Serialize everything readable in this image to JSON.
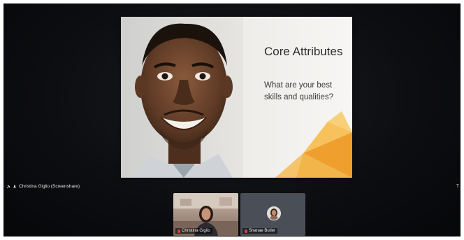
{
  "slide": {
    "title": "Core Attributes",
    "body": "What are your best skills and qualities?"
  },
  "presenter": {
    "label": "Christina Giglio (Screenshare)"
  },
  "edge_label": "T",
  "participants": [
    {
      "name": "Christina Giglio"
    },
    {
      "name": "Shanae Butler"
    }
  ],
  "colors": {
    "background": "#0c0d10",
    "accent_orange": "#f3a93a",
    "mic_muted": "#e04040"
  },
  "icons": [
    "pin-icon",
    "mic-icon",
    "muted-mic-icon"
  ]
}
